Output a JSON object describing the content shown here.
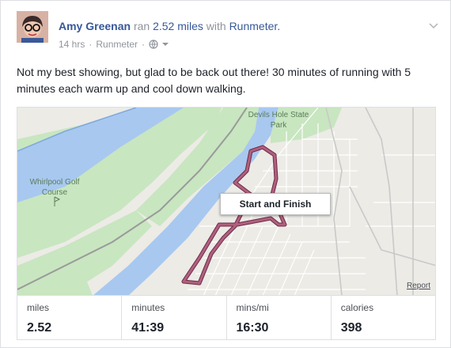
{
  "post": {
    "author": "Amy Greenan",
    "action": "ran",
    "distance": "2.52 miles",
    "with_word": "with",
    "app_name": "Runmeter.",
    "time_ago": "14 hrs",
    "source": "Runmeter",
    "dot": "·",
    "privacy_icon": "globe-icon",
    "menu_icon": "chevron-down-icon",
    "body": "Not my best showing, but glad to be back out there! 30 minutes of running with 5 minutes each warm up and cool down walking."
  },
  "map": {
    "park_label": "Devils Hole State Park",
    "golf_label": "Whirlpool Golf Course",
    "callout": "Start and Finish",
    "report_link": "Report",
    "colors": {
      "water": "#a8c8f0",
      "park": "#c8e6c0",
      "route": "#a0506e"
    }
  },
  "stats": [
    {
      "label": "miles",
      "value": "2.52"
    },
    {
      "label": "minutes",
      "value": "41:39"
    },
    {
      "label": "mins/mi",
      "value": "16:30"
    },
    {
      "label": "calories",
      "value": "398"
    }
  ]
}
